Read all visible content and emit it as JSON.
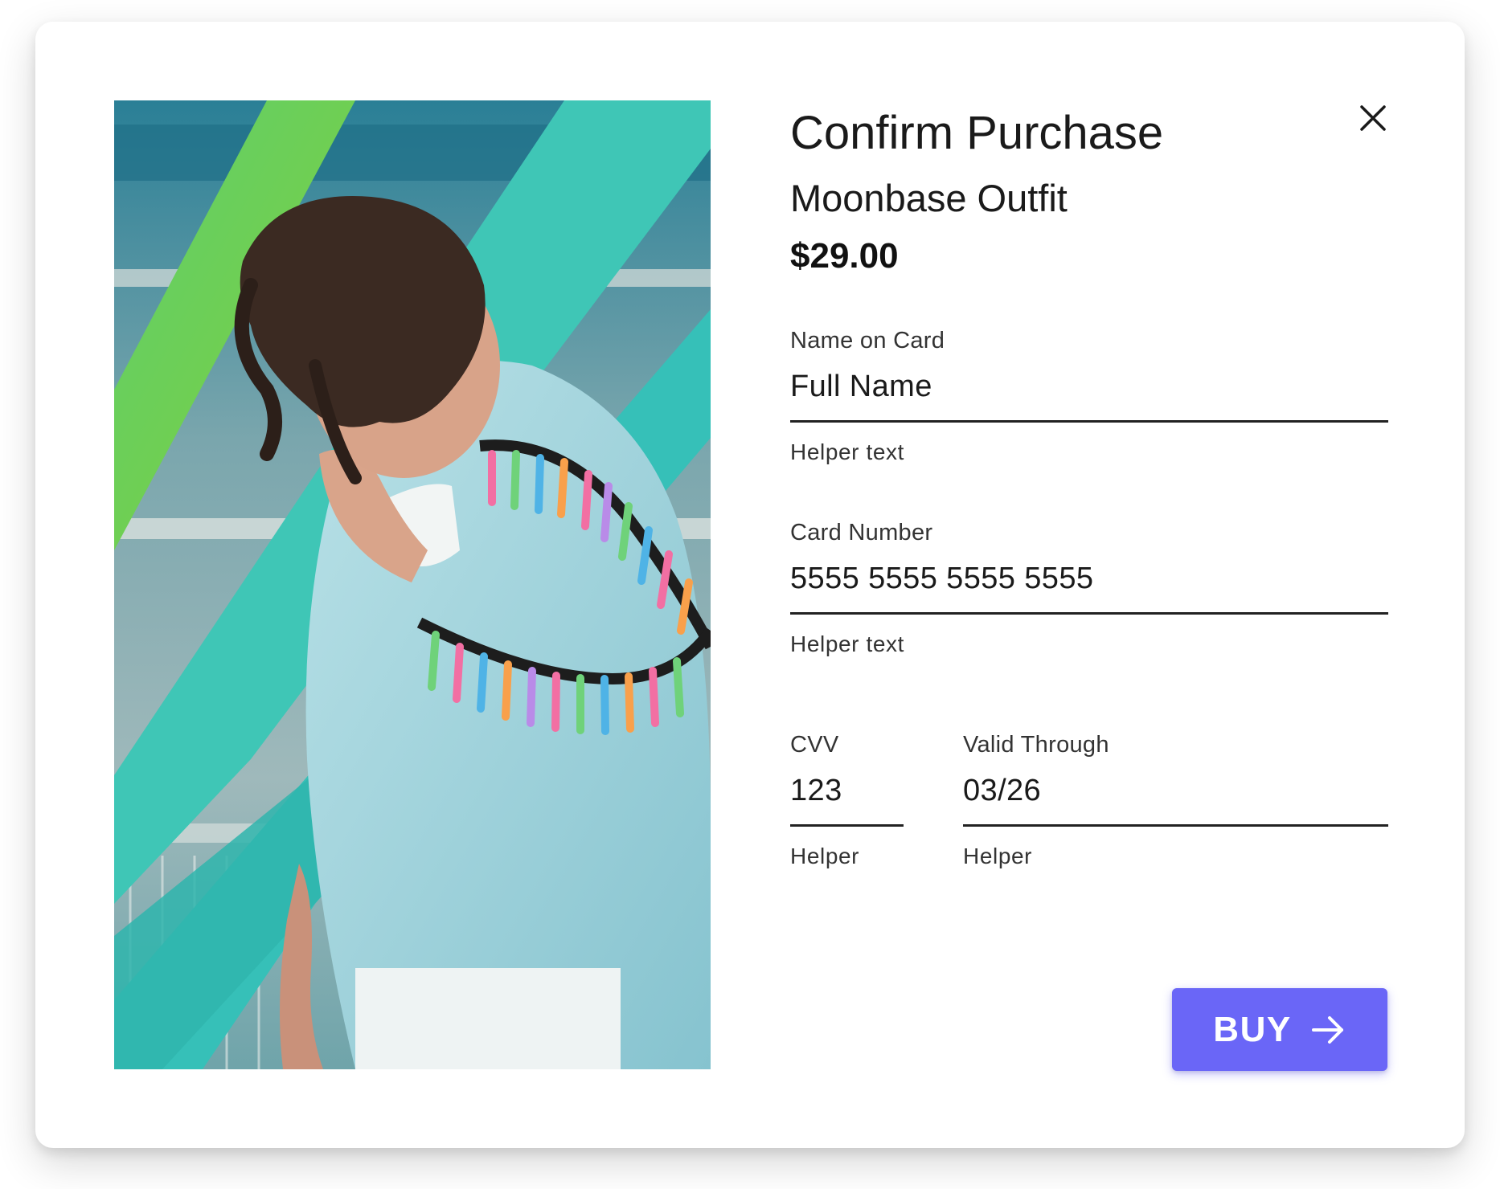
{
  "dialog": {
    "title": "Confirm Purchase",
    "product_name": "Moonbase Outfit",
    "price": "$29.00",
    "close_icon": "close-icon",
    "photo": {
      "icon": "product-photo",
      "colors": {
        "beam_teal": "#3ec7bd",
        "beam_green": "#6fcf59",
        "jacket": "#9ed3dc"
      }
    }
  },
  "form": {
    "name_field": {
      "label": "Name on Card",
      "value": "Full Name",
      "helper": "Helper text"
    },
    "card_field": {
      "label": "Card Number",
      "value": "5555 5555 5555 5555",
      "helper": "Helper text"
    },
    "cvv_field": {
      "label": "CVV",
      "value": "123",
      "helper": "Helper"
    },
    "valid_field": {
      "label": "Valid Through",
      "value": "03/26",
      "helper": "Helper"
    }
  },
  "buy_button": {
    "label": "BUY",
    "icon": "arrow-right-icon",
    "color": "#6a66f7"
  }
}
